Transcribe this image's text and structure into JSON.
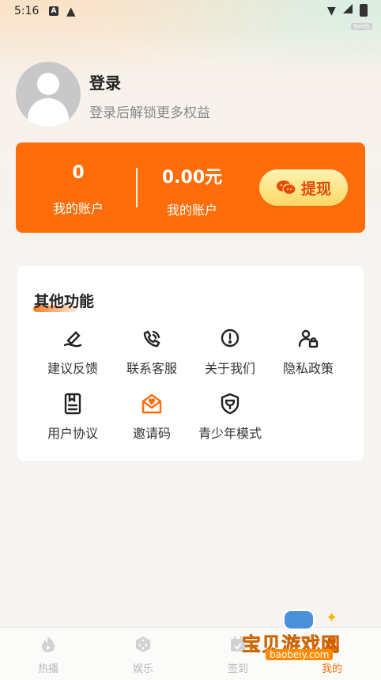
{
  "status_bar": {
    "time": "5:16",
    "notification_badge": "A",
    "tag": "9mtb"
  },
  "profile": {
    "title": "登录",
    "subtitle": "登录后解锁更多权益"
  },
  "wallet": {
    "left_value": "0",
    "left_label": "我的账户",
    "right_value": "0.00元",
    "right_label": "我的账户",
    "withdraw_label": "提现",
    "colors": {
      "card": "#ff6d0a",
      "button_text": "#e24a08"
    }
  },
  "other_functions": {
    "title": "其他功能",
    "items": [
      {
        "label": "建议反馈",
        "icon": "feedback-pen-icon"
      },
      {
        "label": "联系客服",
        "icon": "phone-support-icon"
      },
      {
        "label": "关于我们",
        "icon": "info-alert-icon"
      },
      {
        "label": "隐私政策",
        "icon": "privacy-user-lock-icon"
      },
      {
        "label": "用户协议",
        "icon": "agreement-document-icon"
      },
      {
        "label": "邀请码",
        "icon": "invite-envelope-icon"
      },
      {
        "label": "青少年模式",
        "icon": "teen-shield-icon"
      }
    ]
  },
  "bottom_nav": {
    "tabs": [
      {
        "label": "热播",
        "icon": "play-flame-icon",
        "active": false
      },
      {
        "label": "娱乐",
        "icon": "dice-icon",
        "active": false
      },
      {
        "label": "签到",
        "icon": "calendar-check-icon",
        "active": false
      },
      {
        "label": "我的",
        "icon": "user-icon",
        "active": true
      }
    ]
  },
  "watermark": {
    "text": "宝贝游戏网",
    "url": "baobeiy.com"
  }
}
